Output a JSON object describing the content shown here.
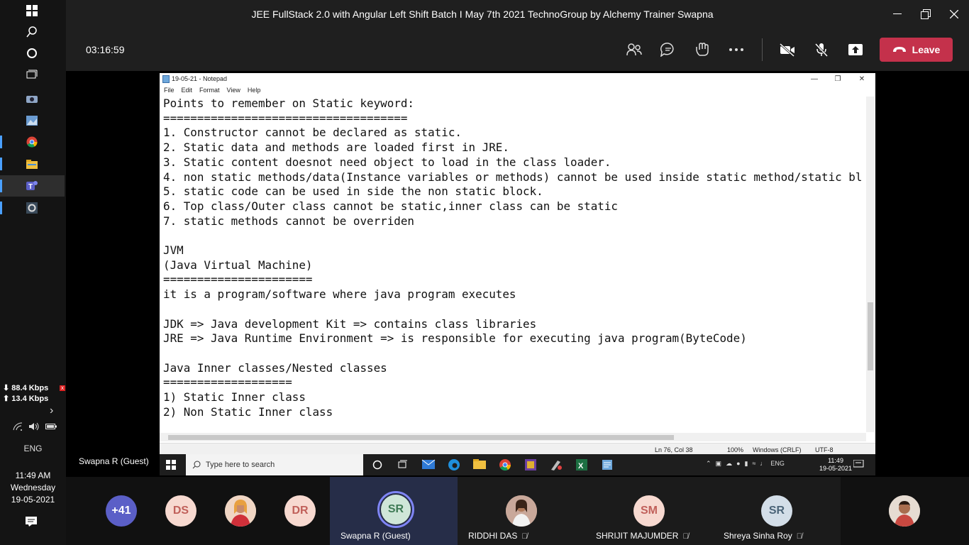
{
  "window": {
    "title": "JEE FullStack 2.0 with Angular Left Shift Batch I May 7th 2021 TechnoGroup by Alchemy Trainer Swapna"
  },
  "call": {
    "timer": "03:16:59",
    "leave_label": "Leave"
  },
  "rail": {
    "download": "⬇ 88.4 Kbps",
    "upload": "⬆ 13.4 Kbps",
    "lang": "ENG",
    "time": "11:49 AM",
    "day": "Wednesday",
    "date": "19-05-2021"
  },
  "presenter": "Swapna R (Guest)",
  "notepad": {
    "title": "19-05-21 - Notepad",
    "menu": [
      "File",
      "Edit",
      "Format",
      "View",
      "Help"
    ],
    "text": "Points to remember on Static keyword:\n====================================\n1. Constructor cannot be declared as static.\n2. Static data and methods are loaded first in JRE.\n3. Static content doesnot need object to load in the class loader.\n4. non static methods/data(Instance variables or methods) cannot be used inside static method/static bl\n5. static code can be used in side the non static block.\n6. Top class/Outer class cannot be static,inner class can be static\n7. static methods cannot be overriden\n\nJVM\n(Java Virtual Machine)\n======================\nit is a program/software where java program executes\n\nJDK => Java development Kit => contains class libraries\nJRE => Java Runtime Environment => is responsible for executing java program(ByteCode)\n\nJava Inner classes/Nested classes\n===================\n1) Static Inner class\n2) Non Static Inner class",
    "status": {
      "position": "Ln 76, Col 38",
      "zoom": "100%",
      "line_ending": "Windows (CRLF)",
      "encoding": "UTF-8"
    }
  },
  "inner_taskbar": {
    "search_placeholder": "Type here to search",
    "lang": "ENG",
    "time": "11:49",
    "date": "19-05-2021"
  },
  "participants": {
    "overflow": "+41",
    "avatars": [
      {
        "initials": "DS",
        "color": "#f7d9d0",
        "text_color": "#c0605a"
      },
      {
        "initials": "DR",
        "color": "#f7d9d0",
        "text_color": "#c0605a"
      },
      {
        "initials": "SR",
        "color": "#cfe6d8",
        "text_color": "#3e7a55"
      },
      {
        "initials": "SM",
        "color": "#f7d9d0",
        "text_color": "#c0605a"
      },
      {
        "initials": "SR",
        "color": "#d3dee8",
        "text_color": "#4b6478"
      }
    ],
    "names": [
      "Swapna R (Guest)",
      "RIDDHI DAS",
      "SHRIJIT MAJUMDER",
      "Shreya Sinha Roy"
    ]
  },
  "colors": {
    "leave": "#c4314b",
    "overflow_badge": "#5b5fc7",
    "speaking_ring": "#7f85f5"
  }
}
